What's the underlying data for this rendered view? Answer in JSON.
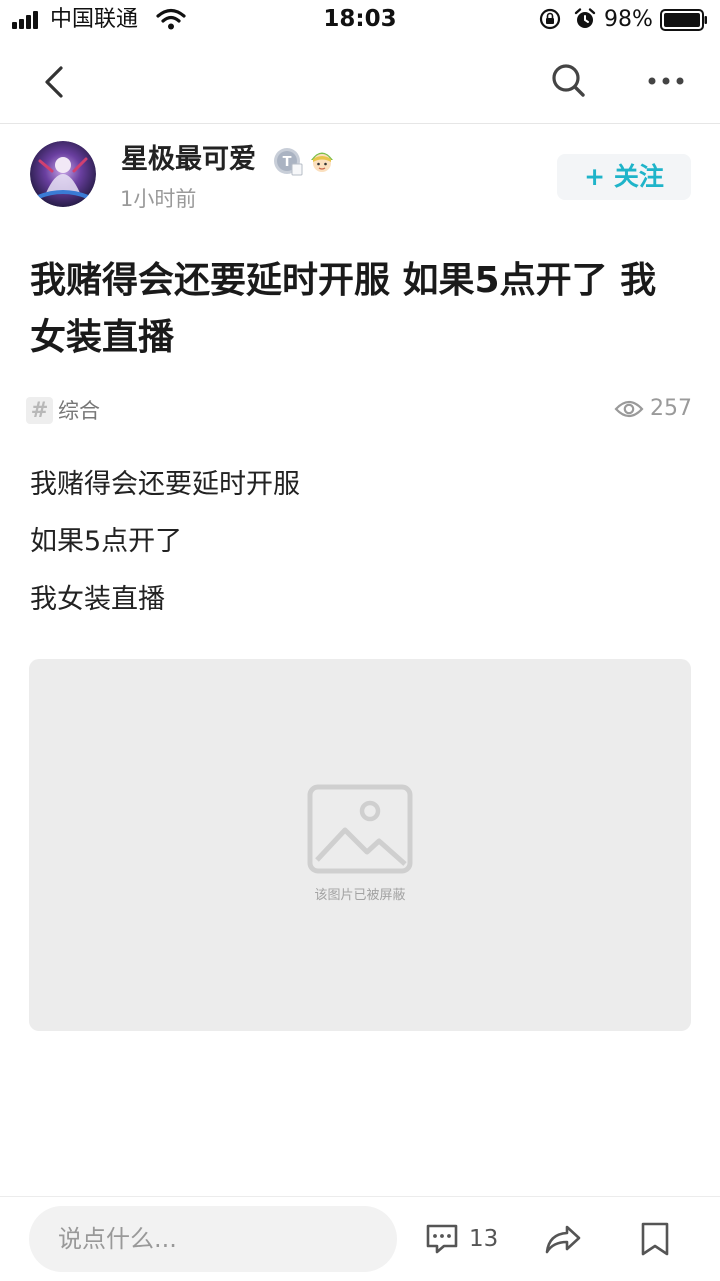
{
  "status_bar": {
    "carrier": "中国联通",
    "time": "18:03",
    "battery_percent": "98%"
  },
  "nav": {
    "back_icon": "chevron-left-icon",
    "search_icon": "search-icon",
    "more_icon": "more-dots-icon"
  },
  "author": {
    "name": "星极最可爱",
    "time_ago": "1小时前",
    "follow_label": "关注",
    "follow_prefix": "+"
  },
  "post": {
    "title": "我赌得会还要延时开服 如果5点开了 我女装直播",
    "tag": "综合",
    "tag_glyph": "#",
    "views": "257",
    "body_lines": [
      "我赌得会还要延时开服",
      "如果5点开了",
      "我女装直播"
    ],
    "image_caption": "该图片已被屏蔽"
  },
  "bottom_bar": {
    "input_placeholder": "说点什么...",
    "comment_count": "13"
  },
  "colors": {
    "accent": "#1fb4c9",
    "placeholder_bg": "#ececec",
    "muted_text": "#9a9a9a"
  }
}
